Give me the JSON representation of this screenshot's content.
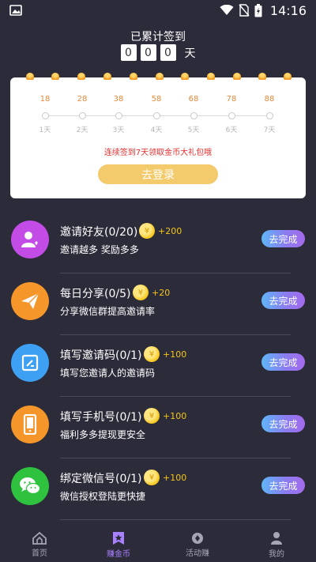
{
  "status_bar": {
    "time": "14:16",
    "icons": [
      "image-icon",
      "wifi-icon",
      "no-sim-icon",
      "battery-charging-icon"
    ]
  },
  "checkin": {
    "title": "已累计签到",
    "digits": [
      "0",
      "0",
      "0"
    ],
    "unit": "天"
  },
  "card": {
    "coins": [
      "18",
      "28",
      "38",
      "58",
      "68",
      "78",
      "88"
    ],
    "days": [
      "1天",
      "2天",
      "3天",
      "4天",
      "5天",
      "6天",
      "7天"
    ],
    "promo": "连续签到7天领取金币大礼包哦",
    "login_label": "去登录"
  },
  "tasks": [
    {
      "title": "邀请好友(0/20)",
      "reward": "+200",
      "desc": "邀请越多 奖励多多",
      "button": "去完成",
      "icon": "user-heart-icon",
      "color": "#c34ce6"
    },
    {
      "title": "每日分享(0/5)",
      "reward": "+20",
      "desc": "分享微信群提高邀请率",
      "button": "去完成",
      "icon": "paper-plane-icon",
      "color": "#f5962a"
    },
    {
      "title": "填写邀请码(0/1)",
      "reward": "+100",
      "desc": "填写您邀请人的邀请码",
      "button": "去完成",
      "icon": "edit-code-icon",
      "color": "#3ea0f2"
    },
    {
      "title": "填写手机号(0/1)",
      "reward": "+100",
      "desc": "福利多多提现更安全",
      "button": "去完成",
      "icon": "phone-icon",
      "color": "#f5962a"
    },
    {
      "title": "绑定微信号(0/1)",
      "reward": "+100",
      "desc": "微信授权登陆更快捷",
      "button": "去完成",
      "icon": "wechat-icon",
      "color": "#2fc23f"
    }
  ],
  "nav": [
    {
      "label": "首页",
      "icon": "home-icon",
      "active": false
    },
    {
      "label": "赚金币",
      "icon": "star-bookmark-icon",
      "active": true
    },
    {
      "label": "活动赚",
      "icon": "diamond-icon",
      "active": false
    },
    {
      "label": "我的",
      "icon": "user-icon",
      "active": false
    }
  ],
  "colors": {
    "background": "#2c2b3a",
    "accent_purple": "#a980ff",
    "coin_gold": "#f5c518",
    "login_yellow": "#f3cb6d",
    "promo_red": "#e02d2d"
  }
}
